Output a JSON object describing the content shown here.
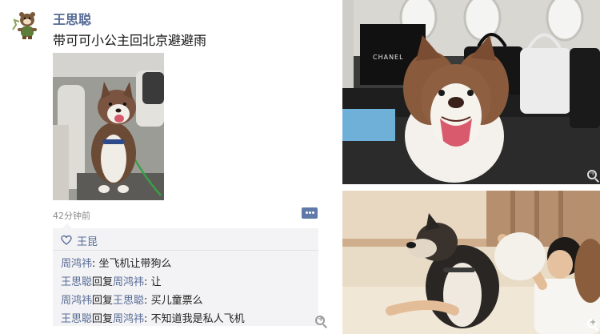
{
  "post": {
    "author": "王思聪",
    "caption": "带可可小公主回北京避避雨",
    "time": "42分钟前",
    "likes": "王昆",
    "comments": [
      {
        "name": "周鸿祎",
        "sep": ": ",
        "text": "坐飞机让带狗么"
      },
      {
        "name": "王思聪",
        "reply": "回复",
        "target": "周鸿祎",
        "sep": ": ",
        "text": "让"
      },
      {
        "name": "周鸿祎",
        "reply": "回复",
        "target": "王思聪",
        "sep": ": ",
        "text": "买儿童票么"
      },
      {
        "name": "王思聪",
        "reply": "回复",
        "target": "周鸿祎",
        "sep": ": ",
        "text": "不知道我是私人飞机"
      }
    ]
  },
  "photos": {
    "top_bag_brand": "CHANEL"
  },
  "icons": [
    "avatar-bear-icon",
    "heart-icon",
    "comment-icon",
    "zoom-in-icon"
  ],
  "colors": {
    "name_link": "#576b95",
    "comment_bg": "#f3f3f5",
    "time": "#8a8a8a"
  }
}
